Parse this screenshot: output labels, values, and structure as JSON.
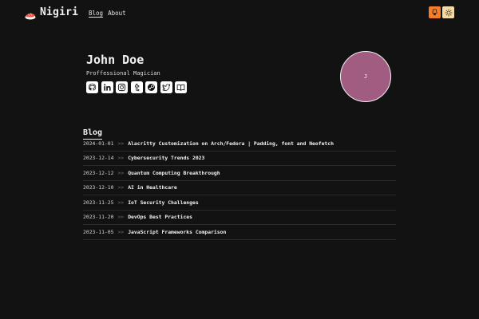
{
  "header": {
    "brand": "Nigiri",
    "nav": [
      {
        "label": "Blog",
        "active": true
      },
      {
        "label": "About",
        "active": false
      }
    ],
    "actions": [
      {
        "icon": "lamp-icon",
        "color": "#f57c2a"
      },
      {
        "icon": "sun-icon",
        "color": "#f4dca8"
      }
    ]
  },
  "profile": {
    "name": "John Doe",
    "title": "Proffessional Magician",
    "avatar_initial": "J",
    "avatar_color": "#a15c82",
    "socials": [
      {
        "icon": "github-icon"
      },
      {
        "icon": "linkedin-icon"
      },
      {
        "icon": "instagram-icon"
      },
      {
        "icon": "tumblr-icon"
      },
      {
        "icon": "steam-icon"
      },
      {
        "icon": "twitter-icon"
      },
      {
        "icon": "book-icon"
      }
    ]
  },
  "blog": {
    "heading": "Blog",
    "separator": ">>",
    "posts": [
      {
        "date": "2024-01-01",
        "title": "Alacritty Customization on Arch/Fedora | Padding, font and Neofetch"
      },
      {
        "date": "2023-12-14",
        "title": "Cybersecurity Trends 2023"
      },
      {
        "date": "2023-12-12",
        "title": "Quantum Computing Breakthrough"
      },
      {
        "date": "2023-12-10",
        "title": "AI in Healthcare"
      },
      {
        "date": "2023-11-25",
        "title": "IoT Security Challenges"
      },
      {
        "date": "2023-11-20",
        "title": "DevOps Best Practices"
      },
      {
        "date": "2023-11-05",
        "title": "JavaScript Frameworks Comparison"
      }
    ]
  }
}
